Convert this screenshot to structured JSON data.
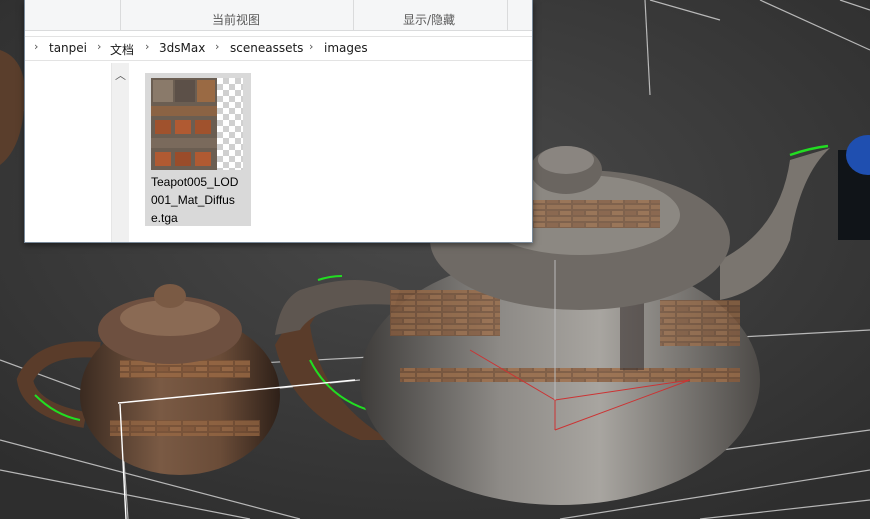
{
  "explorer": {
    "ribbon": {
      "current_view_label": "当前视图",
      "show_hide_label": "显示/隐藏"
    },
    "address_bar": {
      "crumbs": [
        "tanpei",
        "文档",
        "3dsMax",
        "sceneassets",
        "images"
      ]
    },
    "files": [
      {
        "name": "Teapot005_LOD001_Mat_Diffuse.tga",
        "name_lines": [
          "Teapot005_LOD",
          "001_Mat_Diffus",
          "e.tga"
        ]
      }
    ]
  },
  "scene": {
    "objects": [
      "small-teapot",
      "large-teapot",
      "blue-cylinder"
    ],
    "colors": {
      "background": "#3a3a3a",
      "grid": "#d0d0d0",
      "selection_edge": "#22dd22",
      "gizmo": "#cc3333",
      "cylinder": "#1f4fb0"
    }
  }
}
